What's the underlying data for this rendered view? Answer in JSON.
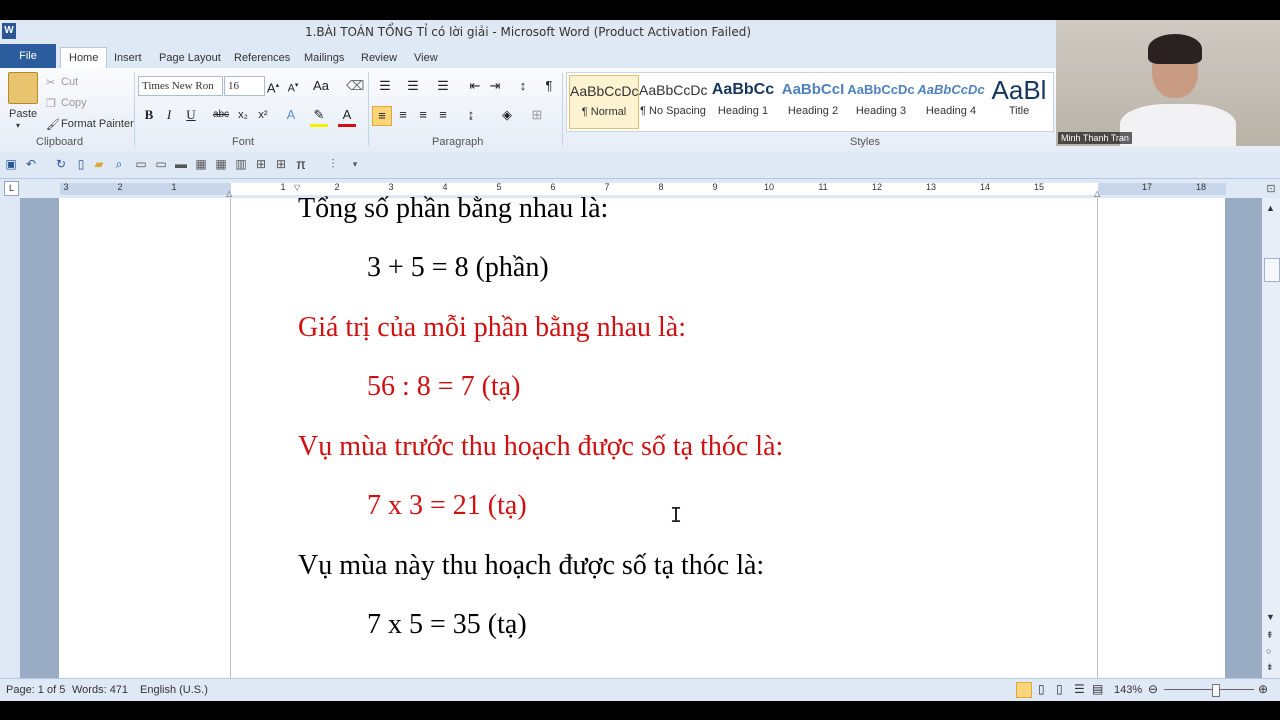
{
  "window": {
    "title": "1.BÀI TOÁN TỔNG TỈ có lời giải  -  Microsoft Word (Product Activation Failed)"
  },
  "tabs": [
    "File",
    "Home",
    "Insert",
    "Page Layout",
    "References",
    "Mailings",
    "Review",
    "View"
  ],
  "clipboard": {
    "paste": "Paste",
    "cut": "Cut",
    "copy": "Copy",
    "format_painter": "Format Painter",
    "group": "Clipboard"
  },
  "font": {
    "name": "Times New Ron",
    "size": "16",
    "group": "Font"
  },
  "paragraph": {
    "group": "Paragraph"
  },
  "styles": {
    "group": "Styles",
    "items": [
      {
        "preview": "AaBbCcDc",
        "name": "¶ Normal"
      },
      {
        "preview": "AaBbCcDc",
        "name": "¶ No Spacing"
      },
      {
        "preview": "AaBbCc",
        "name": "Heading 1"
      },
      {
        "preview": "AaBbCcI",
        "name": "Heading 2"
      },
      {
        "preview": "AaBbCcDc",
        "name": "Heading 3"
      },
      {
        "preview": "AaBbCcDc",
        "name": "Heading 4"
      },
      {
        "preview": "AaBl",
        "name": "Title"
      }
    ]
  },
  "ruler": [
    "3",
    "2",
    "1",
    "1",
    "2",
    "3",
    "4",
    "5",
    "6",
    "7",
    "8",
    "9",
    "10",
    "11",
    "12",
    "13",
    "14",
    "15",
    "17",
    "18"
  ],
  "document": {
    "lines": [
      {
        "text": "Tổng số phần bằng nhau là:",
        "color": "#000000"
      },
      {
        "text": "3 + 5 = 8 (phần)",
        "color": "#000000"
      },
      {
        "text": "Giá trị của mỗi phần bằng nhau là:",
        "color": "#d01010"
      },
      {
        "text": "56 : 8 = 7 (tạ)",
        "color": "#d01010"
      },
      {
        "text": "Vụ mùa trước thu hoạch được số tạ thóc là:",
        "color": "#d01010"
      },
      {
        "text": "7 x 3 = 21 (tạ)",
        "color": "#d01010"
      },
      {
        "text": "Vụ mùa này thu hoạch được số tạ thóc là:",
        "color": "#000000"
      },
      {
        "text": "7 x 5 = 35 (tạ)",
        "color": "#000000"
      }
    ]
  },
  "status": {
    "page": "Page: 1 of 5",
    "words": "Words: 471",
    "language": "English (U.S.)",
    "zoom": "143%"
  },
  "webcam": {
    "name": "Minh Thanh Tran"
  }
}
